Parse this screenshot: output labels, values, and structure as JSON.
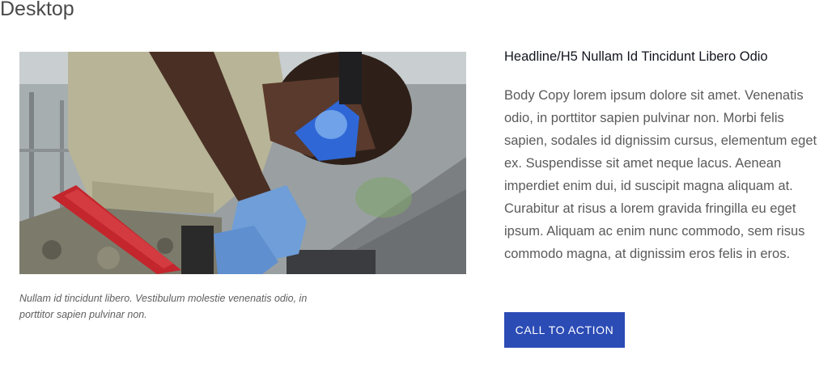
{
  "section_label": "Desktop",
  "media": {
    "image_alt": "Worker wearing safety goggles and blue gloves",
    "caption": "Nullam id tincidunt libero. Vestibulum molestie venenatis odio, in porttitor sapien pulvinar non."
  },
  "content": {
    "headline": "Headline/H5 Nullam Id Tincidunt Libero Odio",
    "body": "Body Copy lorem ipsum dolore sit amet. Venenatis odio, in porttitor sapien pulvinar non. Morbi felis sapien, sodales id dignissim cursus, elementum eget ex. Suspendisse sit amet neque lacus. Aenean imperdiet enim dui, id suscipit magna aliquam at. Curabitur at risus a lorem gravida fringilla eu eget ipsum. Aliquam ac enim nunc commodo, sem risus commodo magna, at dignissim eros felis in eros.",
    "cta_label": "CALL TO ACTION"
  },
  "colors": {
    "cta_background": "#2b4bb5",
    "cta_text": "#ffffff",
    "headline": "#13151f",
    "body": "#5a5a5a"
  }
}
